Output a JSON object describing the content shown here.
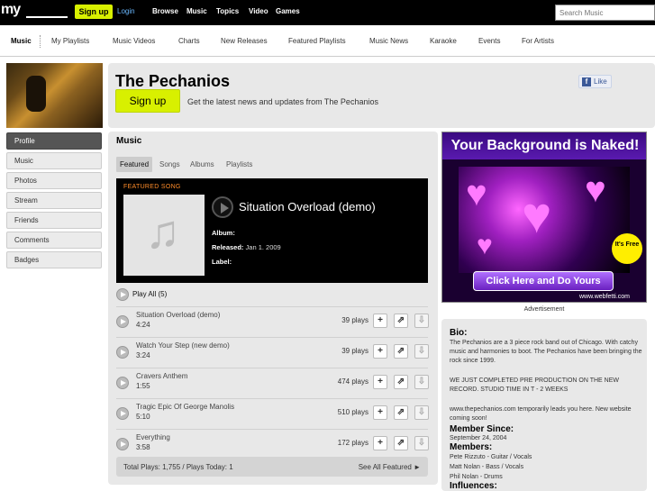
{
  "topbar": {
    "logo": "my",
    "signup": "Sign up",
    "login": "Login",
    "nav": [
      "Browse",
      "Music",
      "Topics",
      "Video",
      "Games"
    ],
    "search_placeholder": "Search Music"
  },
  "subnav": [
    "Music",
    "My Playlists",
    "Music Videos",
    "Charts",
    "New Releases",
    "Featured Playlists",
    "Music News",
    "Karaoke",
    "Events",
    "For Artists"
  ],
  "band": {
    "name": "The Pechanios",
    "signup": "Sign up",
    "tagline": "Get the latest news and updates from The Pechanios",
    "like": "Like"
  },
  "sidebar": [
    "Profile",
    "Music",
    "Photos",
    "Stream",
    "Friends",
    "Comments",
    "Badges"
  ],
  "music": {
    "title": "Music",
    "tabs": [
      "Featured",
      "Songs",
      "Albums",
      "Playlists"
    ],
    "featured_label": "FEATURED SONG",
    "featured_title": "Situation Overload (demo)",
    "album_label": "Album:",
    "released_label": "Released:",
    "released_value": "Jan 1. 2009",
    "label_label": "Label:",
    "play_all": "Play All (5)",
    "songs": [
      {
        "name": "Situation Overload (demo)",
        "duration": "4:24",
        "plays": "39 plays"
      },
      {
        "name": "Watch Your Step (new demo)",
        "duration": "3:24",
        "plays": "39 plays"
      },
      {
        "name": "Cravers Anthem",
        "duration": "1:55",
        "plays": "474 plays"
      },
      {
        "name": "Tragic Epic Of George Manolis",
        "duration": "5:10",
        "plays": "510 plays"
      },
      {
        "name": "Everything",
        "duration": "3:58",
        "plays": "172 plays"
      }
    ],
    "total": "Total Plays: 1,755 / Plays Today: 1",
    "see_all": "See All Featured ►"
  },
  "ad": {
    "headline": "Your Background is Naked!",
    "badge": "It's Free",
    "cta": "Click Here and Do Yours",
    "url": "www.webfetti.com",
    "label": "Advertisement"
  },
  "bio": {
    "bio_heading": "Bio:",
    "bio_text": "The Pechanios are a 3 piece rock band out of Chicago. With catchy music and harmonies to boot. The Pechanios have been bringing the rock since 1999.",
    "bio_text2": "WE JUST COMPLETED PRE PRODUCTION ON THE NEW RECORD. STUDIO TIME IN T - 2 WEEKS",
    "bio_text3": "www.thepechanios.com temporarily leads you here. New website coming soon!",
    "member_since_heading": "Member Since:",
    "member_since": "September 24, 2004",
    "members_heading": "Members:",
    "members": [
      "Pete Rizzuto - Guitar / Vocals",
      "Matt Nolan - Bass / Vocals",
      "Phil Nolan - Drums"
    ],
    "influences_heading": "Influences:"
  }
}
